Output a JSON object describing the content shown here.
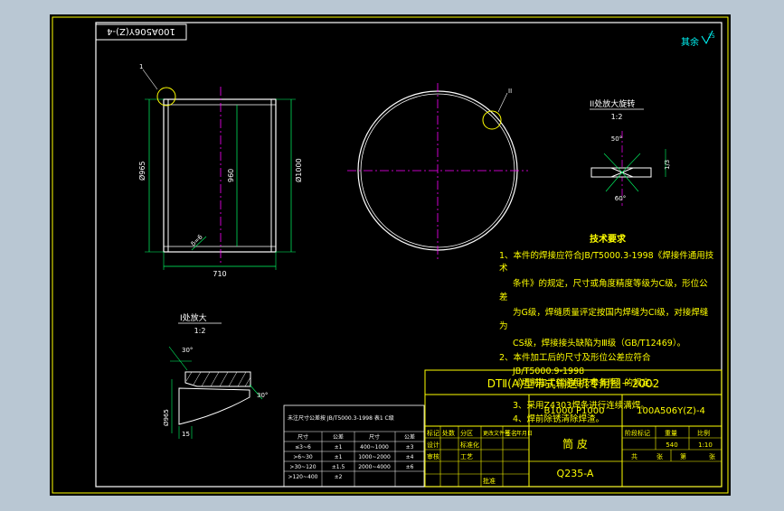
{
  "drawing": {
    "stamp_top_left": "100A506Y(Z)-4",
    "roughness_note": "其余",
    "roughness_value": "25",
    "balloon_1": "1",
    "balloon_2": "II",
    "detail_1_title": "II处放大旋转",
    "detail_1_scale": "1:2",
    "detail_1_angle_top": "50°",
    "detail_1_angle_bottom": "60°",
    "detail_1_depth": "1/3",
    "detail_2_title": "I处放大",
    "detail_2_scale": "1:2",
    "detail_2_angle_top": "30°",
    "detail_2_angle_side": "30°",
    "detail_2_dia": "Ø965",
    "detail_2_width": "15",
    "dim_length": "710",
    "dim_height": "960",
    "dim_dia_left": "Ø965",
    "dim_dia_right": "Ø1000",
    "dim_leader": "δ=6",
    "tech_title": "技术要求",
    "tech_lines": [
      "1、本件的焊接应符合JB/T5000.3-1998《焊接件通用技",
      "术",
      "条件》的规定，尺寸或角度精度等级为C级，形位公",
      "差",
      "为G级，焊缝质量评定按国内焊缝为CI级，对接焊缝",
      "为",
      "CS级，焊接接头缺陷为Ⅲ级（GB/T12469）。",
      "2、本件加工后的尺寸及形位公差应符合",
      "JB/T5000.9-1998",
      "《切削加工件通用技术条件》的规定。",
      "3、采用Z4303焊条进行连续满焊。",
      "4、焊前除锈清除焊渣。"
    ],
    "title_series": "DTⅡ(A)型带式输送机专用图－2002",
    "code_left": "B1000 P1000",
    "code_right": "100A506Y(Z)-4",
    "part_name": "筒 皮",
    "material": "Q235-A",
    "mass_value": "540",
    "scale_value": "1:10",
    "tb_header_cells": [
      "标记",
      "处数",
      "分区",
      "更改文件号",
      "签名",
      "年月日"
    ],
    "tb_side_cells": [
      "设计",
      "审核",
      "工艺",
      "标准化",
      "批准"
    ],
    "tb_right_labels": [
      "阶段标记",
      "重量",
      "比例"
    ],
    "tb_bottom_labels": [
      "共",
      "张",
      "第",
      "张"
    ],
    "tol_note": "未注尺寸公差按 JB/T5000.3-1998 表1 C级",
    "tol_header": [
      "尺寸",
      "公差",
      "尺寸",
      "公差"
    ],
    "tol_rows": [
      [
        "≤3~6",
        "±1",
        "400~1000",
        "±3"
      ],
      [
        ">6~30",
        "±1",
        "1000~2000",
        "±4"
      ],
      [
        ">30~120",
        "±1.5",
        "2000~4000",
        "±6"
      ],
      [
        ">120~400",
        "±2",
        "",
        ""
      ]
    ]
  }
}
